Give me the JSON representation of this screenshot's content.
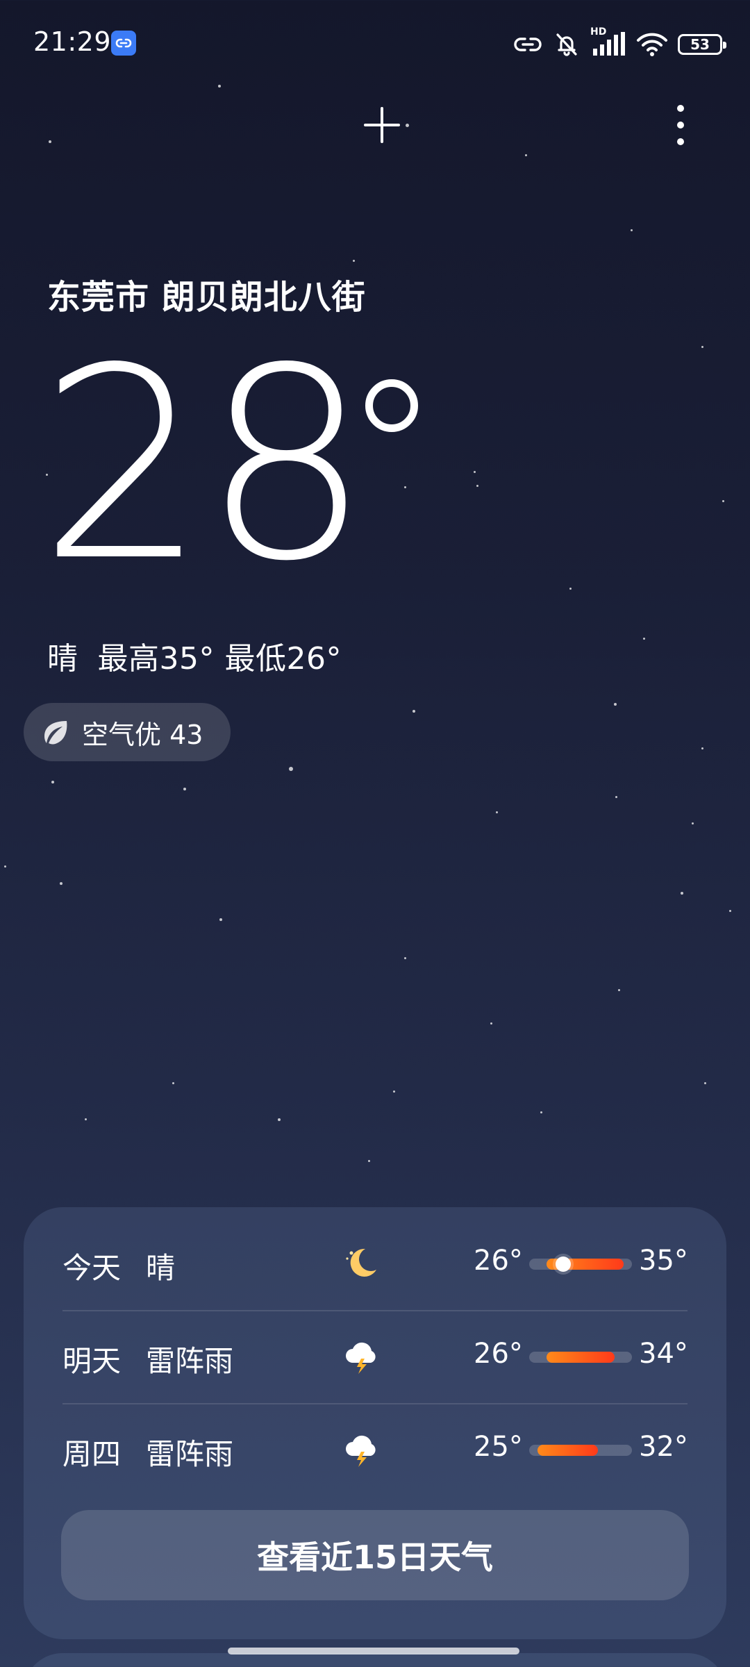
{
  "status_bar": {
    "time": "21:29",
    "network_label": "HD",
    "battery": "53"
  },
  "location": "东莞市 朗贝朗北八街",
  "current": {
    "temperature": "28",
    "condition": "晴",
    "high_low": "最高35° 最低26°"
  },
  "aqi": {
    "label": "空气优 43"
  },
  "forecast": [
    {
      "day": "今天",
      "condition": "晴",
      "icon": "moon-icon",
      "low": "26°",
      "high": "35°",
      "low_value": 26,
      "high_value": 35,
      "now_value": 28
    },
    {
      "day": "明天",
      "condition": "雷阵雨",
      "icon": "thunderstorm-icon",
      "low": "26°",
      "high": "34°",
      "low_value": 26,
      "high_value": 34
    },
    {
      "day": "周四",
      "condition": "雷阵雨",
      "icon": "thunderstorm-icon",
      "low": "25°",
      "high": "32°",
      "low_value": 25,
      "high_value": 32
    }
  ],
  "forecast_range": {
    "min": 24,
    "max": 36
  },
  "forecast_button": "查看近15日天气",
  "colors": {
    "accent_bar_start": "#ff8a1a",
    "accent_bar_end": "#ff3a1a",
    "app_badge": "#3b7bf6"
  }
}
